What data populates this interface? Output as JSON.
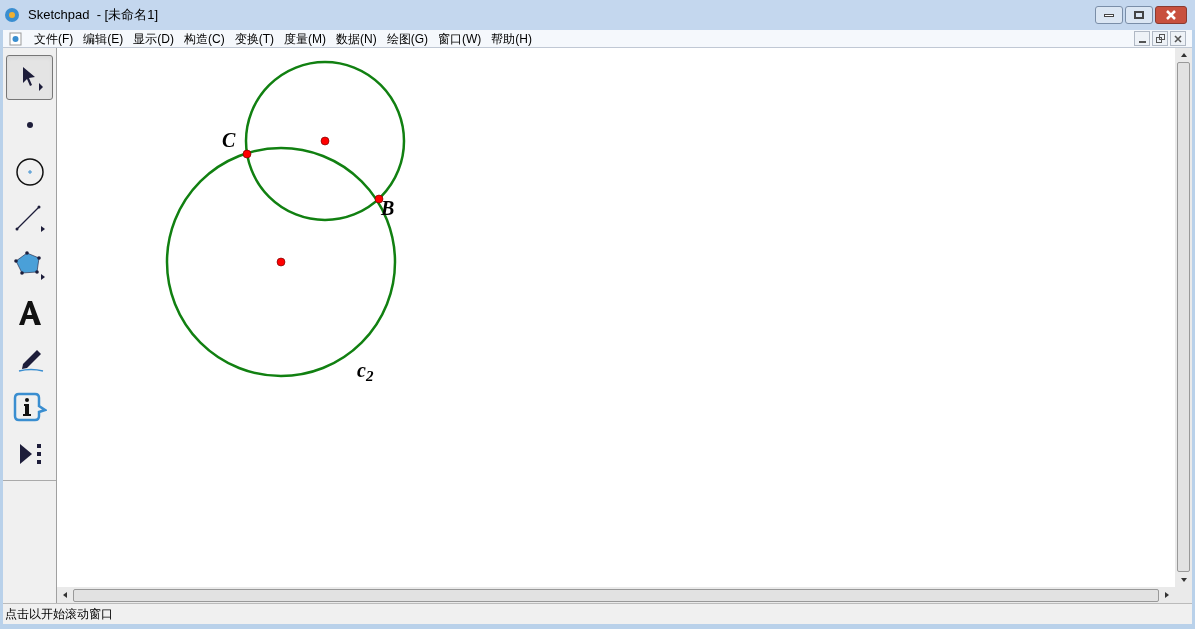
{
  "window": {
    "title": "Sketchpad  - [未命名1]"
  },
  "menu": [
    "文件(F)",
    "编辑(E)",
    "显示(D)",
    "构造(C)",
    "变换(T)",
    "度量(M)",
    "数据(N)",
    "绘图(G)",
    "窗口(W)",
    "帮助(H)"
  ],
  "tools": [
    {
      "kind": "select",
      "selected": true
    },
    {
      "kind": "point",
      "selected": false
    },
    {
      "kind": "compass",
      "selected": false
    },
    {
      "kind": "line",
      "selected": false
    },
    {
      "kind": "polygon",
      "selected": false
    },
    {
      "kind": "text",
      "selected": false
    },
    {
      "kind": "marker",
      "selected": false
    },
    {
      "kind": "info",
      "selected": false
    },
    {
      "kind": "custom",
      "selected": false
    }
  ],
  "labels": [
    {
      "text": "C"
    },
    {
      "text": "B"
    },
    {
      "text": "c$_{2}$"
    }
  ],
  "status_bar": "点击以开始滚动窗口"
}
